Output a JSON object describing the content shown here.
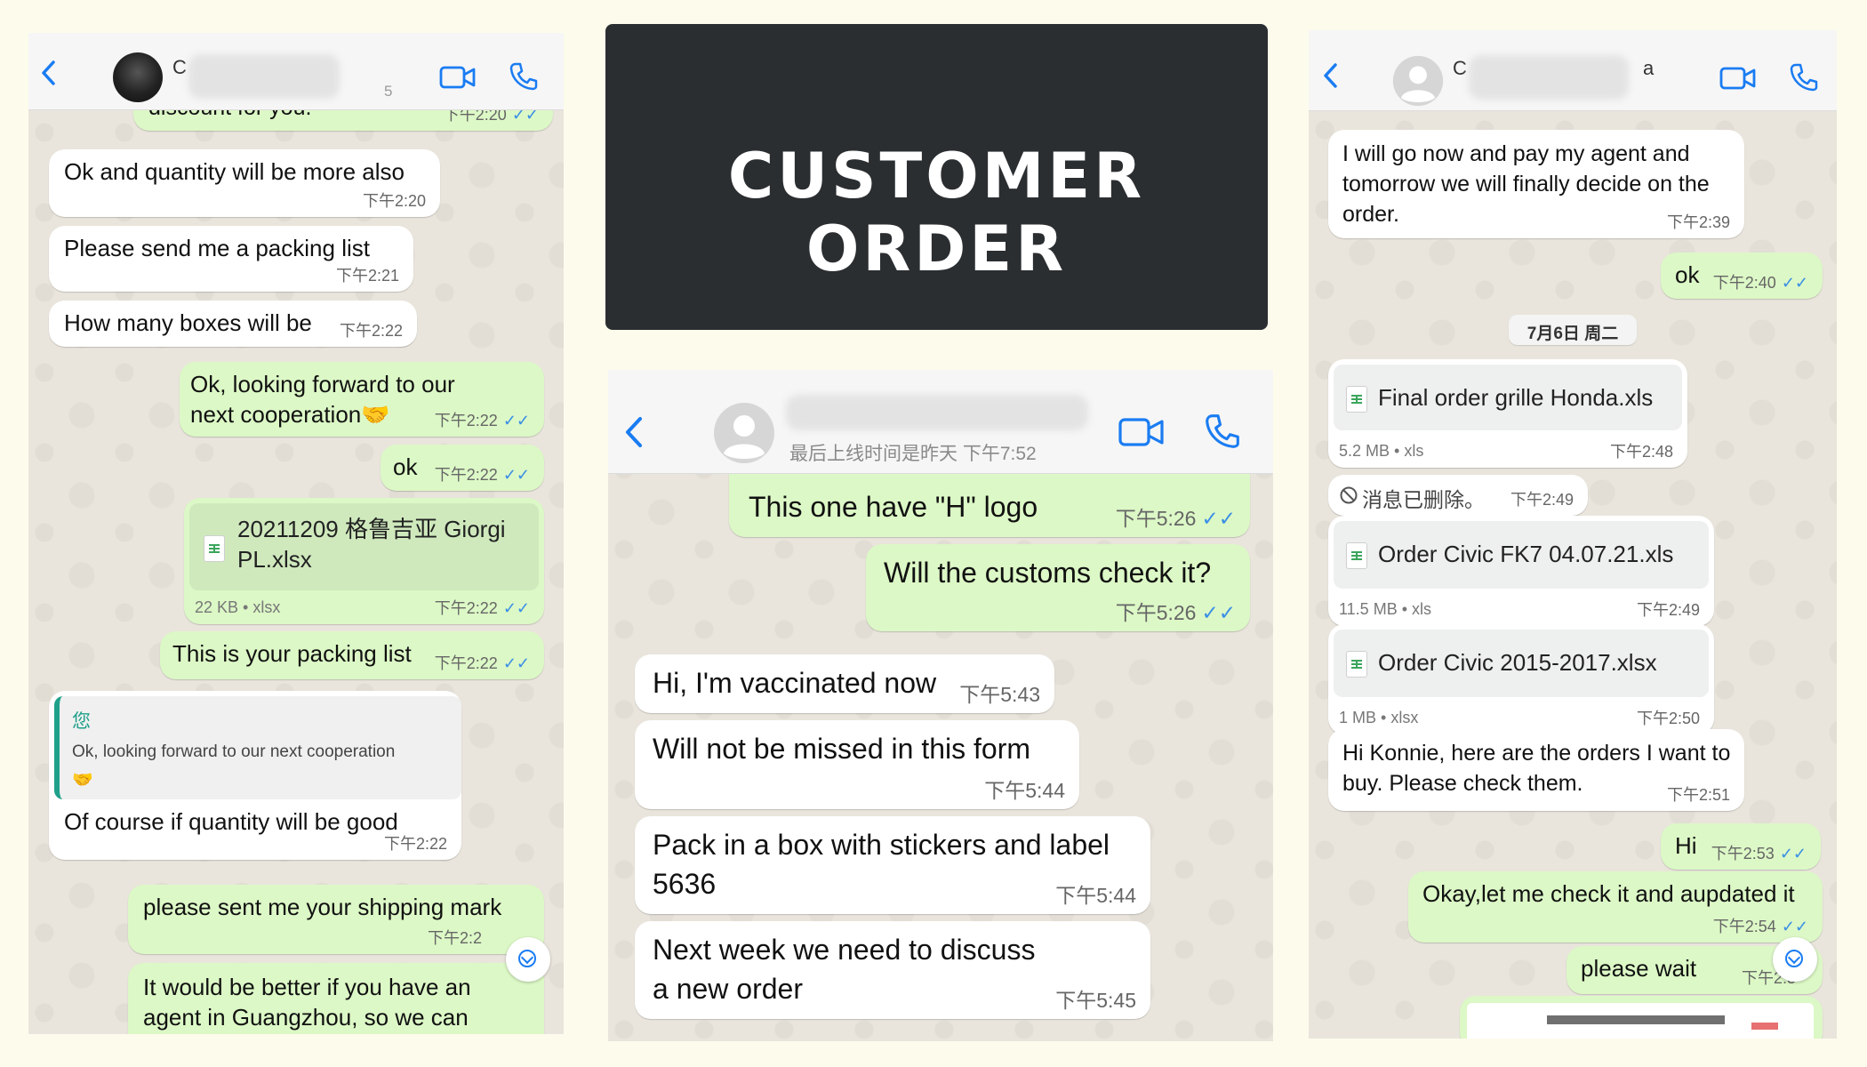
{
  "banner": {
    "title": "CUSTOMER ORDER"
  },
  "colors": {
    "accent": "#1a7cf2",
    "outgoing_bubble": "#dcf8c6",
    "incoming_bubble": "#ffffff",
    "banner_bg": "#2b2e31"
  },
  "left_chat": {
    "header": {
      "name_initial": "C",
      "status": "5"
    },
    "messages": [
      {
        "text": "discount for you.",
        "time": "下午2:20"
      },
      {
        "text": "Ok and quantity will be more also",
        "time": "下午2:20"
      },
      {
        "text": "Please send me a packing list",
        "time": "下午2:21"
      },
      {
        "text": "How many boxes will be",
        "time": "下午2:22"
      },
      {
        "text": "Ok, looking forward to our next cooperation🤝",
        "time": "下午2:22"
      },
      {
        "text": "ok",
        "time": "下午2:22"
      },
      {
        "file_name": "20211209 格鲁吉亚 Giorgi PL.xlsx",
        "file_meta": "22 KB • xlsx",
        "time": "下午2:22"
      },
      {
        "text": "This is your packing list",
        "time": "下午2:22"
      },
      {
        "quote_author": "您",
        "quote_text": "Ok, looking forward to our next cooperation",
        "quote_emoji": "🤝",
        "text": "Of course if quantity will be good",
        "time": "下午2:22"
      },
      {
        "text": "please sent me your shipping mark",
        "time": "下午2:2"
      },
      {
        "text": "It would be better if you have an agent in Guangzhou, so we can"
      }
    ]
  },
  "middle_chat": {
    "header": {
      "status": "最后上线时间是昨天 下午7:52"
    },
    "messages": [
      {
        "text": "This one have \"H\" logo",
        "time": "下午5:26"
      },
      {
        "text": "Will the customs check it?",
        "time": "下午5:26"
      },
      {
        "text": "Hi, I'm vaccinated now",
        "time": "下午5:43"
      },
      {
        "text": "Will not be missed in this form",
        "time": "下午5:44"
      },
      {
        "text": "Pack in a box with stickers and label 5636",
        "time": "下午5:44"
      },
      {
        "text": "Next week we need to discuss a new order",
        "time": "下午5:45"
      }
    ]
  },
  "right_chat": {
    "header": {
      "name_initial": "C",
      "name_tail": "a"
    },
    "date_divider": "7月6日 周二",
    "messages": [
      {
        "text": "I will go now and pay my agent and tomorrow we will finally decide on the order.",
        "time": "下午2:39"
      },
      {
        "text": "ok",
        "time": "下午2:40"
      },
      {
        "file_name": "Final order grille Honda.xls",
        "file_meta": "5.2 MB • xls",
        "time": "下午2:48"
      },
      {
        "text": "消息已删除。",
        "time": "下午2:49"
      },
      {
        "file_name": "Order Civic FK7 04.07.21.xls",
        "file_meta": "11.5 MB • xls",
        "time": "下午2:49"
      },
      {
        "file_name": "Order Civic 2015-2017.xlsx",
        "file_meta": "1 MB • xlsx",
        "time": "下午2:50"
      },
      {
        "text": "Hi Konnie, here are the orders I want to buy. Please check them.",
        "time": "下午2:51"
      },
      {
        "text": "Hi",
        "time": "下午2:53"
      },
      {
        "text": "Okay,let me check it and aupdated it",
        "time": "下午2:54"
      },
      {
        "text": "please wait",
        "time": "下午2:5"
      }
    ]
  }
}
